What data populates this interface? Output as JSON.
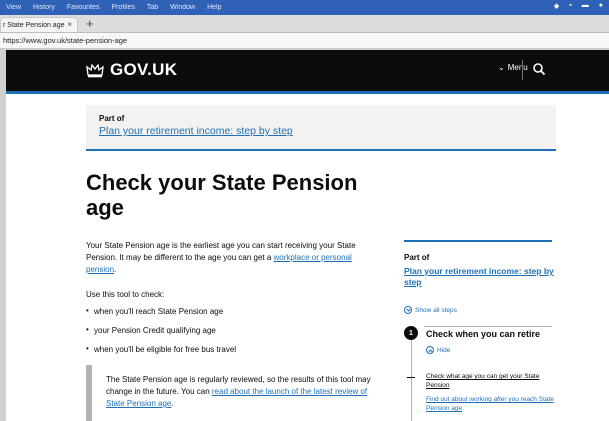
{
  "os_menubar": {
    "items": [
      "View",
      "History",
      "Favourites",
      "Profiles",
      "Tab",
      "Window",
      "Help"
    ]
  },
  "browser": {
    "tab_title": "r State Pension age",
    "tab_close": "×",
    "new_tab": "+",
    "url": "https://www.gov.uk/state-pension-age"
  },
  "header": {
    "logo_text": "GOV.UK",
    "menu_label": "Menu",
    "menu_chevron": "⌄"
  },
  "part_of_banner": {
    "label": "Part of",
    "link": "Plan your retirement income: step by step"
  },
  "main": {
    "title": "Check your State Pension age",
    "intro_before_link": "Your State Pension age is the earliest age you can start receiving your State Pension. It may be different to the age you can get a ",
    "intro_link": "workplace or personal pension",
    "intro_after_link": ".",
    "use_tool": "Use this tool to check:",
    "bullets": [
      "when you'll reach State Pension age",
      "your Pension Credit qualifying age",
      "when you'll be eligible for free bus travel"
    ],
    "inset_before_link": "The State Pension age is regularly reviewed, so the results of this tool may change in the future. You can ",
    "inset_link": "read about the launch of the latest review of State Pension age",
    "inset_after_link": "."
  },
  "sidebar": {
    "part_of": "Part of",
    "link": "Plan your retirement income: step by step",
    "show_all": "Show all steps",
    "step_number": "1",
    "step_title": "Check when you can retire",
    "hide": "Hide",
    "substeps": [
      "Check what age you can get your State Pension",
      "Find out about working after you reach State Pension age"
    ]
  },
  "colors": {
    "link": "#1d70b8",
    "header_bg": "#0b0c0c",
    "banner_bg": "#f3f2f1",
    "menubar": "#2f62b6"
  }
}
